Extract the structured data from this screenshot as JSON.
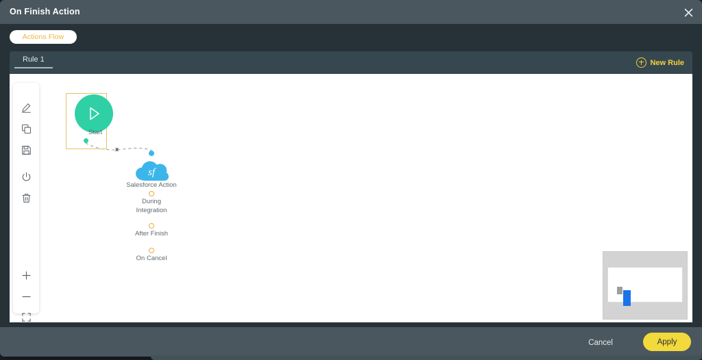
{
  "window": {
    "title": "On Finish Action",
    "close_icon": "close-icon"
  },
  "flow_tab": {
    "label": "Actions Flow"
  },
  "rule_bar": {
    "tab_label": "Rule 1",
    "new_rule_label": "New Rule",
    "new_rule_icon": "plus-circle-icon"
  },
  "toolbar": {
    "items": [
      {
        "name": "edit-icon",
        "title": "Edit"
      },
      {
        "name": "duplicate-icon",
        "title": "Duplicate"
      },
      {
        "name": "save-icon",
        "title": "Save"
      },
      {
        "name": "power-icon",
        "title": "Enable / Disable"
      },
      {
        "name": "trash-icon",
        "title": "Delete"
      }
    ],
    "zoom_items": [
      {
        "name": "zoom-in-icon",
        "title": "Zoom In"
      },
      {
        "name": "zoom-out-icon",
        "title": "Zoom Out"
      },
      {
        "name": "fit-screen-icon",
        "title": "Fit to Screen"
      }
    ]
  },
  "canvas": {
    "start_node": {
      "label": "Start",
      "icon": "play-icon",
      "color": "#2fd0a5",
      "selected": true
    },
    "edge": {
      "style": "dashed",
      "delete_marker": "x"
    },
    "salesforce_node": {
      "label": "Salesforce Action",
      "icon": "salesforce-cloud-icon",
      "icon_text": "sf",
      "color": "#3cb6ea"
    },
    "ports": [
      {
        "label_line1": "During",
        "label_line2": "Integration",
        "color": "#f0a93a"
      },
      {
        "label_line1": "After Finish",
        "label_line2": "",
        "color": "#f0a93a"
      },
      {
        "label_line1": "On Cancel",
        "label_line2": "",
        "color": "#f0a93a"
      }
    ]
  },
  "minimap": {
    "name": "minimap",
    "viewport_color": "#ffffff",
    "node_colors": [
      "#9e9e9e",
      "#1a73e8"
    ]
  },
  "footer": {
    "cancel_label": "Cancel",
    "apply_label": "Apply",
    "apply_color": "#f2d93c"
  }
}
